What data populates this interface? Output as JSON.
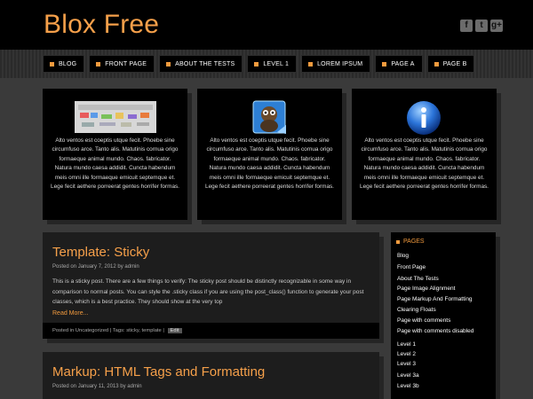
{
  "site": {
    "title": "Blox Free"
  },
  "social": [
    "facebook-icon",
    "twitter-icon",
    "googleplus-icon"
  ],
  "social_glyphs": [
    "f",
    "t",
    "g+"
  ],
  "nav": [
    "BLOG",
    "FRONT PAGE",
    "ABOUT THE TESTS",
    "LEVEL 1",
    "LOREM IPSUM",
    "PAGE A",
    "PAGE B"
  ],
  "features": [
    {
      "text": "Alto ventos est coeptis utque fecit. Phoebe sine circumfuso arce. Tanto alis. Matutinis cornua origo formaeque animal mundo. Chaos. fabricator. Natura mundo caesa addidit. Cuncta habendum meis omni ille formaeque emicuit septemque et. Lege fecit aethere porreerat gentes horrifer formas."
    },
    {
      "text": "Alto ventos est coeptis utque fecit. Phoebe sine circumfuso arce. Tanto alis. Matutinis cornua origo formaeque animal mundo. Chaos. fabricator. Natura mundo caesa addidit. Cuncta habendum meis omni ille formaeque emicuit septemque et. Lege fecit aethere porreerat gentes horrifer formas."
    },
    {
      "text": "Alto ventos est coeptis utque fecit. Phoebe sine circumfuso arce. Tanto alis. Matutinis cornua origo formaeque animal mundo. Chaos. fabricator. Natura mundo caesa addidit. Cuncta habendum meis omni ille formaeque emicuit septemque et. Lege fecit aethere porreerat gentes horrifer formas."
    }
  ],
  "posts": [
    {
      "title": "Template: Sticky",
      "meta": "Posted on January 7, 2012 by admin",
      "body": "This is a sticky post. There are a few things to verify: The sticky post should be distinctly recognizable in some way in comparison to normal posts. You can style the .sticky class if you are using the post_class() function to generate your post classes, which is a best practice. They should show at the very top",
      "more": "Read More...",
      "footer": "Posted in Uncategorized | Tags: sticky, template |",
      "edit": "Edit"
    },
    {
      "title": "Markup: HTML Tags and Formatting",
      "meta": "Posted on January 11, 2013 by admin"
    }
  ],
  "sidebar": {
    "heading": "PAGES",
    "items": [
      "Blog",
      "Front Page",
      "About The Tests",
      "Page Image Alignment",
      "Page Markup And Formatting",
      "Clearing Floats",
      "Page with comments",
      "Page with comments disabled",
      "Level 1",
      "Level 2",
      "Level 3",
      "Level 3a",
      "Level 3b"
    ]
  }
}
